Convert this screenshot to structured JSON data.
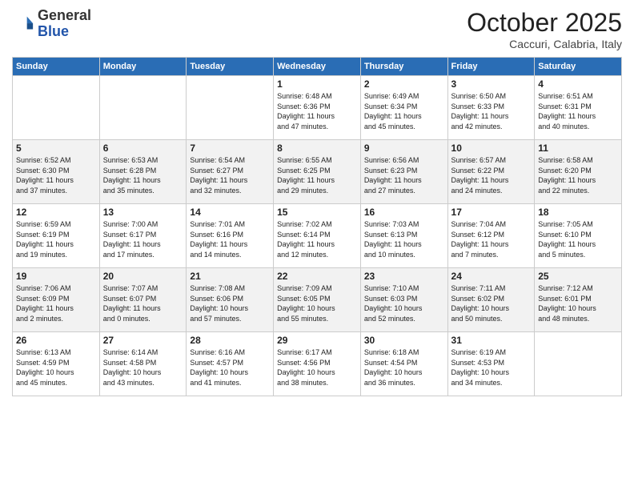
{
  "logo": {
    "general": "General",
    "blue": "Blue"
  },
  "header": {
    "title": "October 2025",
    "subtitle": "Caccuri, Calabria, Italy"
  },
  "weekdays": [
    "Sunday",
    "Monday",
    "Tuesday",
    "Wednesday",
    "Thursday",
    "Friday",
    "Saturday"
  ],
  "rows": [
    [
      {
        "day": "",
        "info": ""
      },
      {
        "day": "",
        "info": ""
      },
      {
        "day": "",
        "info": ""
      },
      {
        "day": "1",
        "info": "Sunrise: 6:48 AM\nSunset: 6:36 PM\nDaylight: 11 hours\nand 47 minutes."
      },
      {
        "day": "2",
        "info": "Sunrise: 6:49 AM\nSunset: 6:34 PM\nDaylight: 11 hours\nand 45 minutes."
      },
      {
        "day": "3",
        "info": "Sunrise: 6:50 AM\nSunset: 6:33 PM\nDaylight: 11 hours\nand 42 minutes."
      },
      {
        "day": "4",
        "info": "Sunrise: 6:51 AM\nSunset: 6:31 PM\nDaylight: 11 hours\nand 40 minutes."
      }
    ],
    [
      {
        "day": "5",
        "info": "Sunrise: 6:52 AM\nSunset: 6:30 PM\nDaylight: 11 hours\nand 37 minutes."
      },
      {
        "day": "6",
        "info": "Sunrise: 6:53 AM\nSunset: 6:28 PM\nDaylight: 11 hours\nand 35 minutes."
      },
      {
        "day": "7",
        "info": "Sunrise: 6:54 AM\nSunset: 6:27 PM\nDaylight: 11 hours\nand 32 minutes."
      },
      {
        "day": "8",
        "info": "Sunrise: 6:55 AM\nSunset: 6:25 PM\nDaylight: 11 hours\nand 29 minutes."
      },
      {
        "day": "9",
        "info": "Sunrise: 6:56 AM\nSunset: 6:23 PM\nDaylight: 11 hours\nand 27 minutes."
      },
      {
        "day": "10",
        "info": "Sunrise: 6:57 AM\nSunset: 6:22 PM\nDaylight: 11 hours\nand 24 minutes."
      },
      {
        "day": "11",
        "info": "Sunrise: 6:58 AM\nSunset: 6:20 PM\nDaylight: 11 hours\nand 22 minutes."
      }
    ],
    [
      {
        "day": "12",
        "info": "Sunrise: 6:59 AM\nSunset: 6:19 PM\nDaylight: 11 hours\nand 19 minutes."
      },
      {
        "day": "13",
        "info": "Sunrise: 7:00 AM\nSunset: 6:17 PM\nDaylight: 11 hours\nand 17 minutes."
      },
      {
        "day": "14",
        "info": "Sunrise: 7:01 AM\nSunset: 6:16 PM\nDaylight: 11 hours\nand 14 minutes."
      },
      {
        "day": "15",
        "info": "Sunrise: 7:02 AM\nSunset: 6:14 PM\nDaylight: 11 hours\nand 12 minutes."
      },
      {
        "day": "16",
        "info": "Sunrise: 7:03 AM\nSunset: 6:13 PM\nDaylight: 11 hours\nand 10 minutes."
      },
      {
        "day": "17",
        "info": "Sunrise: 7:04 AM\nSunset: 6:12 PM\nDaylight: 11 hours\nand 7 minutes."
      },
      {
        "day": "18",
        "info": "Sunrise: 7:05 AM\nSunset: 6:10 PM\nDaylight: 11 hours\nand 5 minutes."
      }
    ],
    [
      {
        "day": "19",
        "info": "Sunrise: 7:06 AM\nSunset: 6:09 PM\nDaylight: 11 hours\nand 2 minutes."
      },
      {
        "day": "20",
        "info": "Sunrise: 7:07 AM\nSunset: 6:07 PM\nDaylight: 11 hours\nand 0 minutes."
      },
      {
        "day": "21",
        "info": "Sunrise: 7:08 AM\nSunset: 6:06 PM\nDaylight: 10 hours\nand 57 minutes."
      },
      {
        "day": "22",
        "info": "Sunrise: 7:09 AM\nSunset: 6:05 PM\nDaylight: 10 hours\nand 55 minutes."
      },
      {
        "day": "23",
        "info": "Sunrise: 7:10 AM\nSunset: 6:03 PM\nDaylight: 10 hours\nand 52 minutes."
      },
      {
        "day": "24",
        "info": "Sunrise: 7:11 AM\nSunset: 6:02 PM\nDaylight: 10 hours\nand 50 minutes."
      },
      {
        "day": "25",
        "info": "Sunrise: 7:12 AM\nSunset: 6:01 PM\nDaylight: 10 hours\nand 48 minutes."
      }
    ],
    [
      {
        "day": "26",
        "info": "Sunrise: 6:13 AM\nSunset: 4:59 PM\nDaylight: 10 hours\nand 45 minutes."
      },
      {
        "day": "27",
        "info": "Sunrise: 6:14 AM\nSunset: 4:58 PM\nDaylight: 10 hours\nand 43 minutes."
      },
      {
        "day": "28",
        "info": "Sunrise: 6:16 AM\nSunset: 4:57 PM\nDaylight: 10 hours\nand 41 minutes."
      },
      {
        "day": "29",
        "info": "Sunrise: 6:17 AM\nSunset: 4:56 PM\nDaylight: 10 hours\nand 38 minutes."
      },
      {
        "day": "30",
        "info": "Sunrise: 6:18 AM\nSunset: 4:54 PM\nDaylight: 10 hours\nand 36 minutes."
      },
      {
        "day": "31",
        "info": "Sunrise: 6:19 AM\nSunset: 4:53 PM\nDaylight: 10 hours\nand 34 minutes."
      },
      {
        "day": "",
        "info": ""
      }
    ]
  ]
}
